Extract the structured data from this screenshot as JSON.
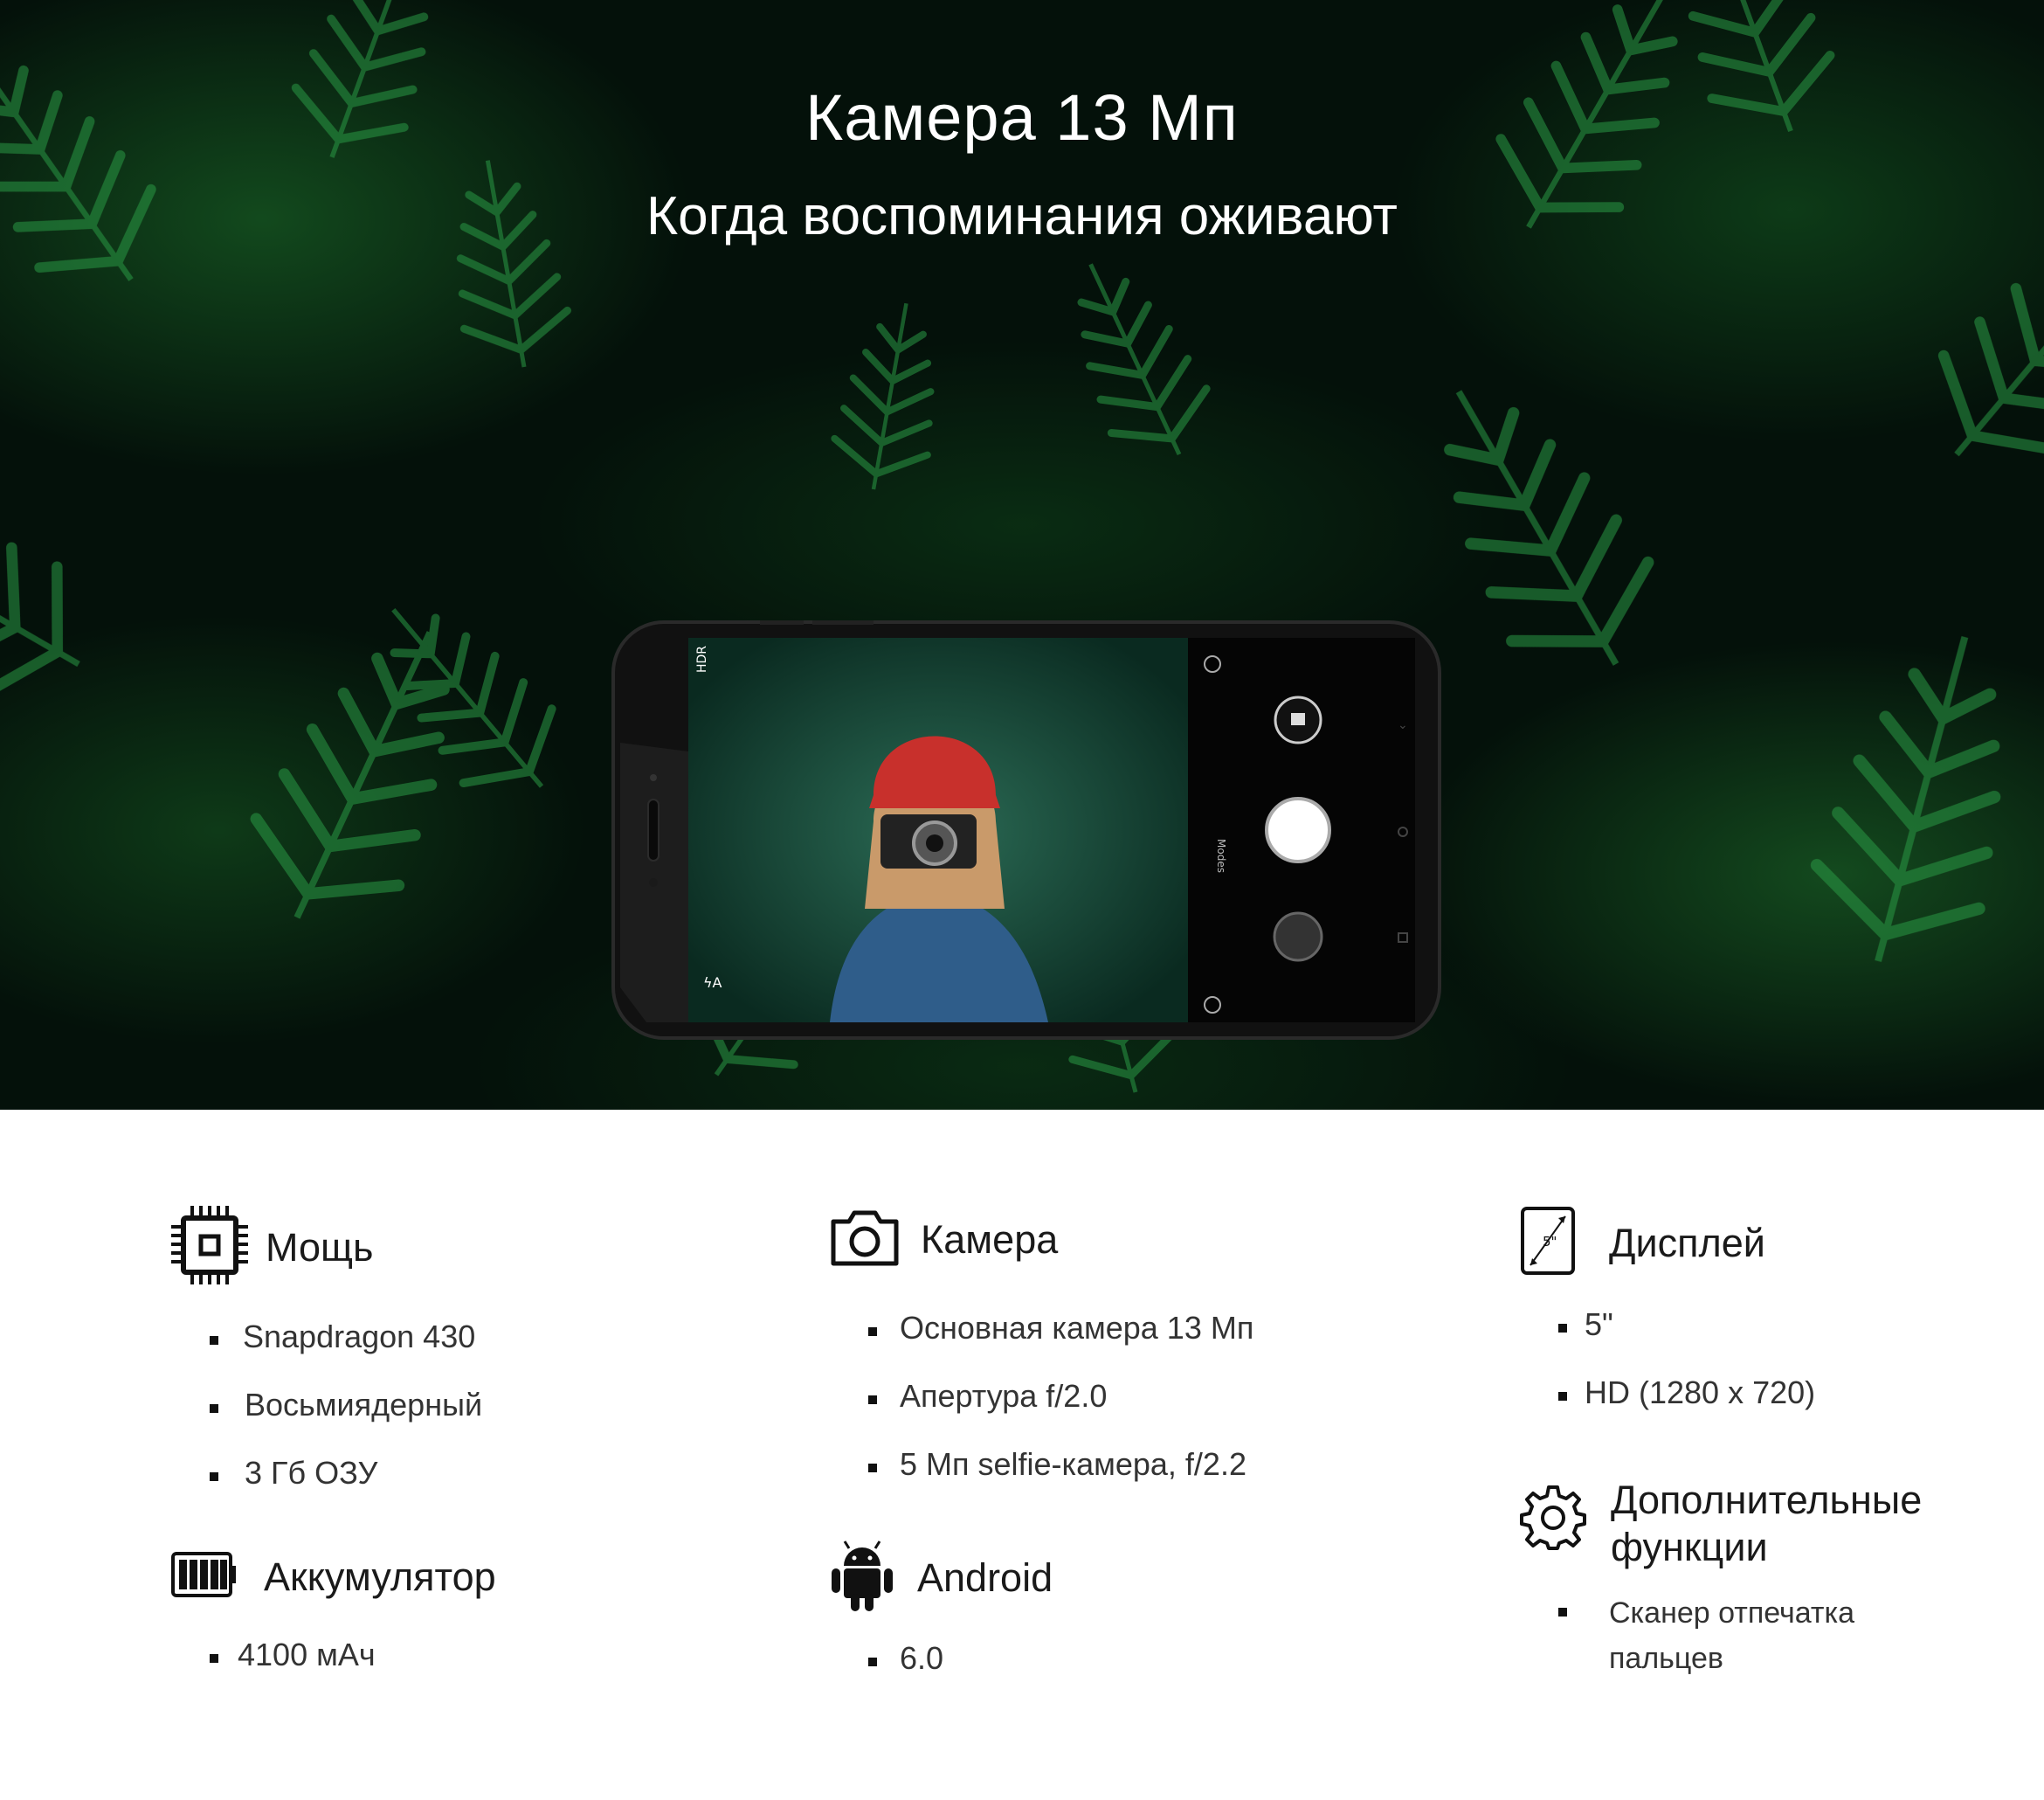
{
  "hero": {
    "title": "Камера 13 Мп",
    "subtitle": "Когда воспоминания оживают"
  },
  "phone_screen": {
    "hdr_label": "HDR",
    "modes_label": "Modes"
  },
  "features": {
    "power": {
      "title": "Мощь",
      "icon": "cpu-chip-icon",
      "items": [
        "Snapdragon 430",
        "Восьмиядерный",
        "3 Гб ОЗУ"
      ]
    },
    "camera": {
      "title": "Камера",
      "icon": "camera-icon",
      "items": [
        "Основная камера 13 Мп",
        "Апертура f/2.0",
        "5 Мп selfie-камера, f/2.2"
      ]
    },
    "display": {
      "title": "Дисплей",
      "icon": "display-size-icon",
      "icon_label": "5\"",
      "items": [
        "5\"",
        "HD (1280 x 720)"
      ]
    },
    "battery": {
      "title": "Аккумулятор",
      "icon": "battery-icon",
      "items": [
        "4100 мАч"
      ]
    },
    "android": {
      "title": "Android",
      "icon": "android-icon",
      "items": [
        "6.0"
      ]
    },
    "extra": {
      "title_line1": "Дополнительные",
      "title_line2": "функции",
      "icon": "gear-icon",
      "item_line1": "Сканер отпечатка",
      "item_line2": "пальцев"
    }
  },
  "colors": {
    "hero_bg": "#04110a",
    "foliage": "#1f8a3a",
    "page_bg": "#ffffff",
    "text": "#1a1a1a"
  }
}
